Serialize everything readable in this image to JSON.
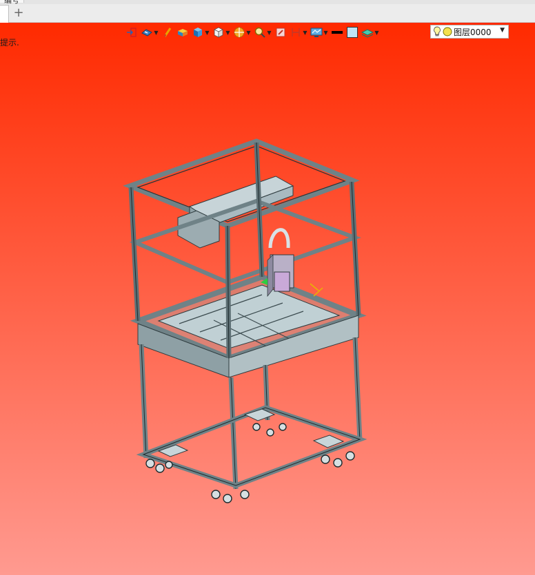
{
  "topstrip": {
    "clipped_tab_label": "编号"
  },
  "tabbar": {
    "add_tab_label": "+"
  },
  "viewport": {
    "hint_text": "提示.",
    "background_top_color": "#ff2a00",
    "background_bottom_color": "#ff9a90"
  },
  "toolbar": {
    "icons": [
      "exit-sketch-icon",
      "view-orientation-icon",
      "measure-icon",
      "part-icon",
      "cube-view-icon",
      "box-icon",
      "sectional-view-icon",
      "zoom-icon",
      "snap-icon",
      "dimension-icon",
      "display-icon",
      "line-color-swatch",
      "fill-color-swatch",
      "layer-manager-icon"
    ],
    "layer": {
      "name": "图层0000"
    }
  }
}
